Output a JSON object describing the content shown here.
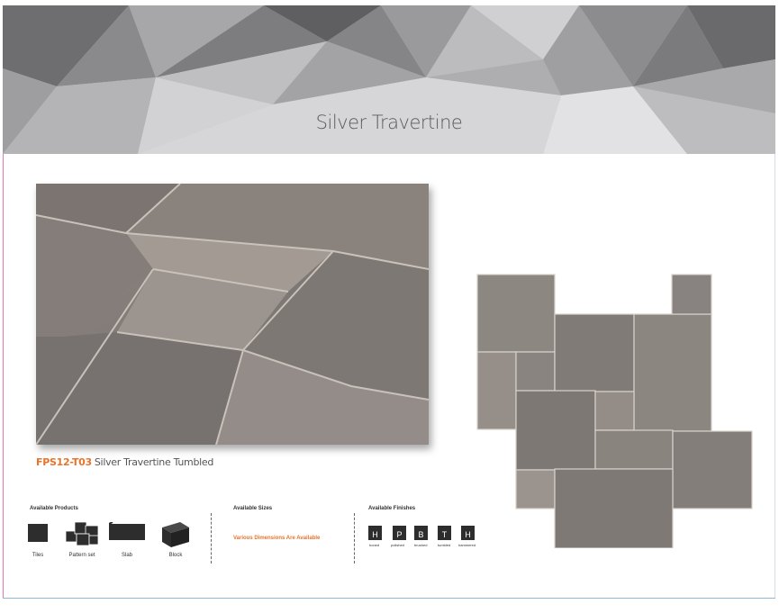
{
  "title": "Silver Travertine",
  "caption": {
    "code": "FPS12-T03",
    "text": "Silver Travertine Tumbled"
  },
  "products": {
    "heading": "Available Products",
    "items": [
      {
        "icon": "tile-icon",
        "label": "Tiles"
      },
      {
        "icon": "pattern-set-icon",
        "label": "Pattern set"
      },
      {
        "icon": "slab-icon",
        "label": "Slab"
      },
      {
        "icon": "block-icon",
        "label": "Block"
      }
    ]
  },
  "sizes": {
    "heading": "Available Sizes",
    "note": "Various Dimensions Are Available"
  },
  "finishes": {
    "heading": "Available Finishes",
    "items": [
      {
        "letter": "H",
        "label": "honed"
      },
      {
        "letter": "P",
        "label": "polished"
      },
      {
        "letter": "B",
        "label": "brushed"
      },
      {
        "letter": "T",
        "label": "tumbled"
      },
      {
        "letter": "H",
        "label": "hammered"
      }
    ]
  },
  "colors": {
    "accent": "#e8732a",
    "icon": "#2d2d2d",
    "stone": "#8a8480",
    "header": "#b9b9bb"
  }
}
